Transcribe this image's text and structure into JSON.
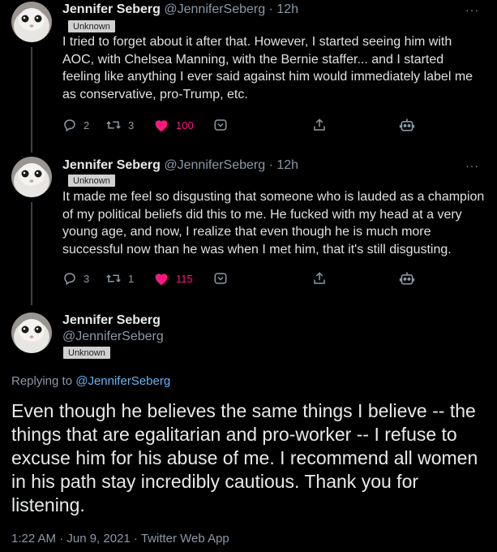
{
  "tweets": [
    {
      "name": "Jennifer Seberg",
      "handle": "@JenniferSeberg",
      "time": "· 12h",
      "badge": "Unknown",
      "text": "I tried to forget about it after that. However, I started seeing him with AOC, with Chelsea Manning, with the Bernie staffer... and I started feeling like anything I ever said against him would immediately label me as conservative, pro-Trump, etc.",
      "replies": "2",
      "retweets": "3",
      "likes": "100"
    },
    {
      "name": "Jennifer Seberg",
      "handle": "@JenniferSeberg",
      "time": "· 12h",
      "badge": "Unknown",
      "text": "It made me feel so disgusting that someone who is lauded as a champion of my political beliefs did this to me. He fucked with my head at a very young age, and now, I realize that even though he is much more successful now than he was when I met him, that it's still disgusting.",
      "replies": "3",
      "retweets": "1",
      "likes": "115"
    }
  ],
  "main": {
    "name": "Jennifer Seberg",
    "handle": "@JenniferSeberg",
    "badge": "Unknown",
    "replying_prefix": "Replying to",
    "replying_handle": "@JenniferSeberg",
    "text": "Even though he believes the same things I believe -- the things that are egalitarian and pro-worker -- I refuse to excuse him for his abuse of me. I recommend all women in his path stay incredibly cautious. Thank you for listening.",
    "timestamp": "1:22 AM · Jun 9, 2021 · Twitter Web App"
  },
  "more_glyph": "···",
  "colors": {
    "background": "#000000",
    "like": "#f91880",
    "link": "#6ab2f2",
    "muted": "#8b98a5"
  }
}
